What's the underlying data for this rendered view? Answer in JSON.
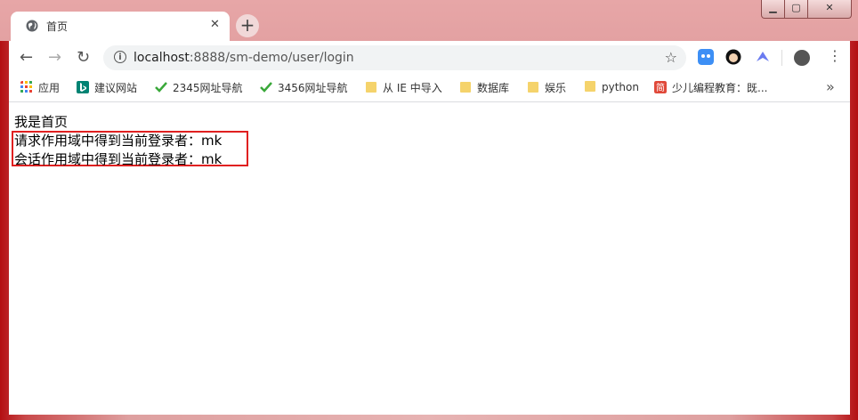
{
  "tab": {
    "title": "首页",
    "close": "✕",
    "new": "+"
  },
  "window_controls": {
    "minimize": "▁",
    "maximize": "▢",
    "close": "✕"
  },
  "toolbar": {
    "back": "←",
    "forward": "→",
    "reload": "↻",
    "url_host": "localhost",
    "url_rest": ":8888/sm-demo/user/login",
    "info_icon": "i",
    "star": "☆",
    "menu": "⋮"
  },
  "bookmarks": [
    {
      "label": "应用",
      "icon": "apps-icon",
      "color": "#4285f4"
    },
    {
      "label": "建议网站",
      "icon": "bing-icon",
      "color": "#008373"
    },
    {
      "label": "2345网址导航",
      "icon": "hao-icon",
      "color": "#3aa83a"
    },
    {
      "label": "3456网址导航",
      "icon": "hao-icon",
      "color": "#3aa83a"
    },
    {
      "label": "从 IE 中导入",
      "icon": "folder-icon",
      "color": "#f5d36b"
    },
    {
      "label": "数据库",
      "icon": "folder-icon",
      "color": "#f5d36b"
    },
    {
      "label": "娱乐",
      "icon": "folder-icon",
      "color": "#f5d36b"
    },
    {
      "label": "python",
      "icon": "folder-icon",
      "color": "#f5d36b"
    },
    {
      "label": "少儿编程教育：既...",
      "icon": "jian-icon",
      "color": "#e0493a"
    }
  ],
  "bookmarks_more": "»",
  "content": {
    "heading": "我是首页",
    "request_line": "请求作用域中得到当前登录者：mk",
    "session_line": "会话作用域中得到当前登录者：mk"
  }
}
